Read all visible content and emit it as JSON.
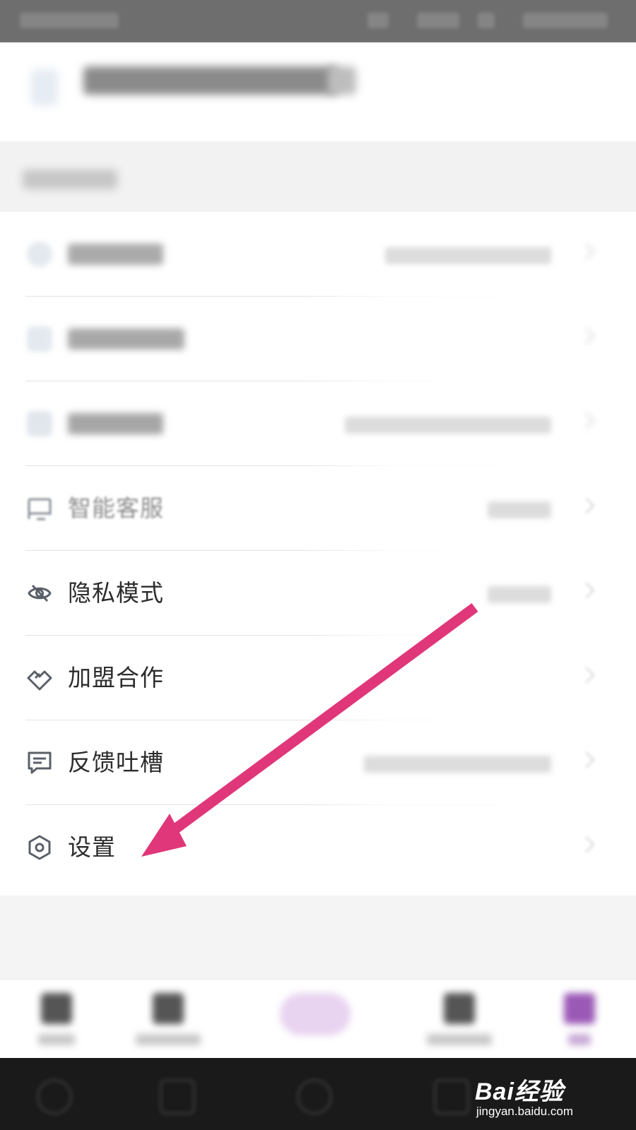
{
  "menu": {
    "items": [
      {
        "label": "智能客服",
        "icon": "headset-icon"
      },
      {
        "label": "隐私模式",
        "icon": "eye-off-icon"
      },
      {
        "label": "加盟合作",
        "icon": "handshake-icon"
      },
      {
        "label": "反馈吐槽",
        "icon": "chat-icon"
      },
      {
        "label": "设置",
        "icon": "hexagon-gear-icon"
      }
    ]
  },
  "annotation": {
    "color": "#E0377A",
    "target": "设置"
  },
  "watermark": {
    "brand": "Bai经验",
    "site": "jingyan.baidu.com"
  },
  "colors": {
    "accent": "#9B59B6",
    "text": "#2C2C2C",
    "icon": "#5A6068"
  }
}
